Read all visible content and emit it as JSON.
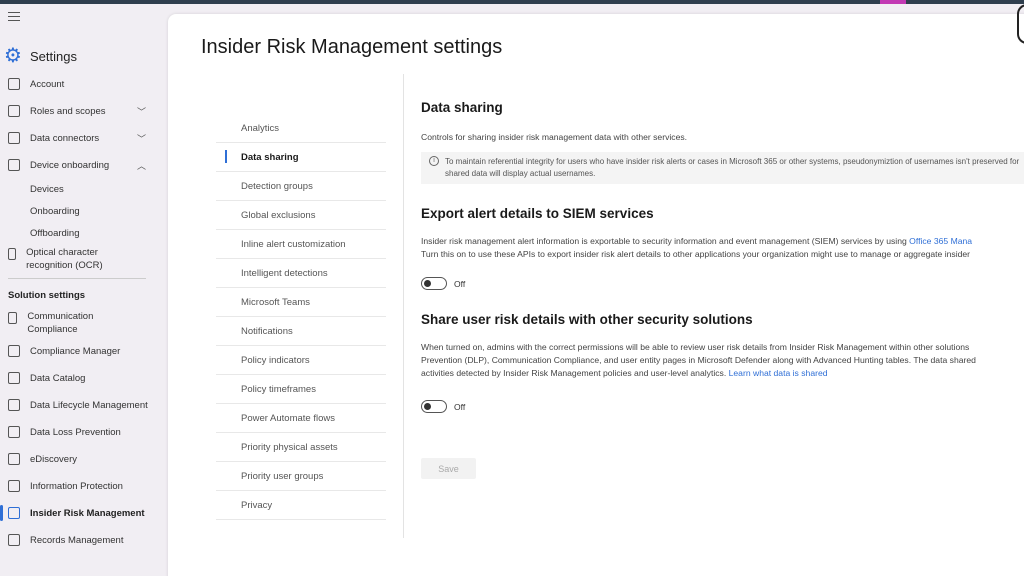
{
  "app": {
    "title": "Settings"
  },
  "leftnav": {
    "items": [
      {
        "label": "Account",
        "icon": "account-icon"
      },
      {
        "label": "Roles and scopes",
        "icon": "roles-icon"
      },
      {
        "label": "Data connectors",
        "icon": "connectors-icon"
      },
      {
        "label": "Device onboarding",
        "icon": "device-icon"
      },
      {
        "label": "Devices"
      },
      {
        "label": "Onboarding"
      },
      {
        "label": "Offboarding"
      },
      {
        "label": "Optical character recognition (OCR)",
        "icon": "ocr-icon"
      }
    ],
    "section_label": "Solution settings",
    "solution_items": [
      {
        "label": "Communication Compliance"
      },
      {
        "label": "Compliance Manager"
      },
      {
        "label": "Data Catalog"
      },
      {
        "label": "Data Lifecycle Management"
      },
      {
        "label": "Data Loss Prevention"
      },
      {
        "label": "eDiscovery"
      },
      {
        "label": "Information Protection"
      },
      {
        "label": "Insider Risk Management"
      },
      {
        "label": "Records Management"
      }
    ]
  },
  "page": {
    "title": "Insider Risk Management settings",
    "inner_nav": [
      "Analytics",
      "Data sharing",
      "Detection groups",
      "Global exclusions",
      "Inline alert customization",
      "Intelligent detections",
      "Microsoft Teams",
      "Notifications",
      "Policy indicators",
      "Policy timeframes",
      "Power Automate flows",
      "Priority physical assets",
      "Priority user groups",
      "Privacy"
    ],
    "data_sharing": {
      "heading": "Data sharing",
      "desc": "Controls for sharing insider risk management data with other services.",
      "info_line1": "To maintain referential integrity for users who have insider risk alerts or cases in Microsoft 365 or other systems, pseudonymiztion of usernames isn't preserved for",
      "info_line2": "shared data will display actual usernames."
    },
    "siem": {
      "heading": "Export alert details to SIEM services",
      "line1": "Insider risk management alert information is exportable to security information and event management (SIEM) services by using ",
      "line1_link": "Office 365 Mana",
      "line2": "Turn this on to use these APIs to export insider risk alert details to other applications your organization might use to manage or aggregate insider",
      "toggle_label": "Off"
    },
    "share": {
      "heading": "Share user risk details with other security solutions",
      "line1": "When turned on, admins with the correct permissions will be able to review user risk details from Insider Risk Management within other solutions",
      "line2": "Prevention (DLP), Communication Compliance, and user entity pages in Microsoft Defender along with Advanced Hunting tables. The data shared",
      "line3": "activities detected by Insider Risk Management policies and user-level analytics. ",
      "line3_link": "Learn what data is shared",
      "toggle_label": "Off"
    },
    "save_label": "Save"
  },
  "colors": {
    "accent": "#2f6fd6",
    "topbar": "#2f3e4e"
  }
}
